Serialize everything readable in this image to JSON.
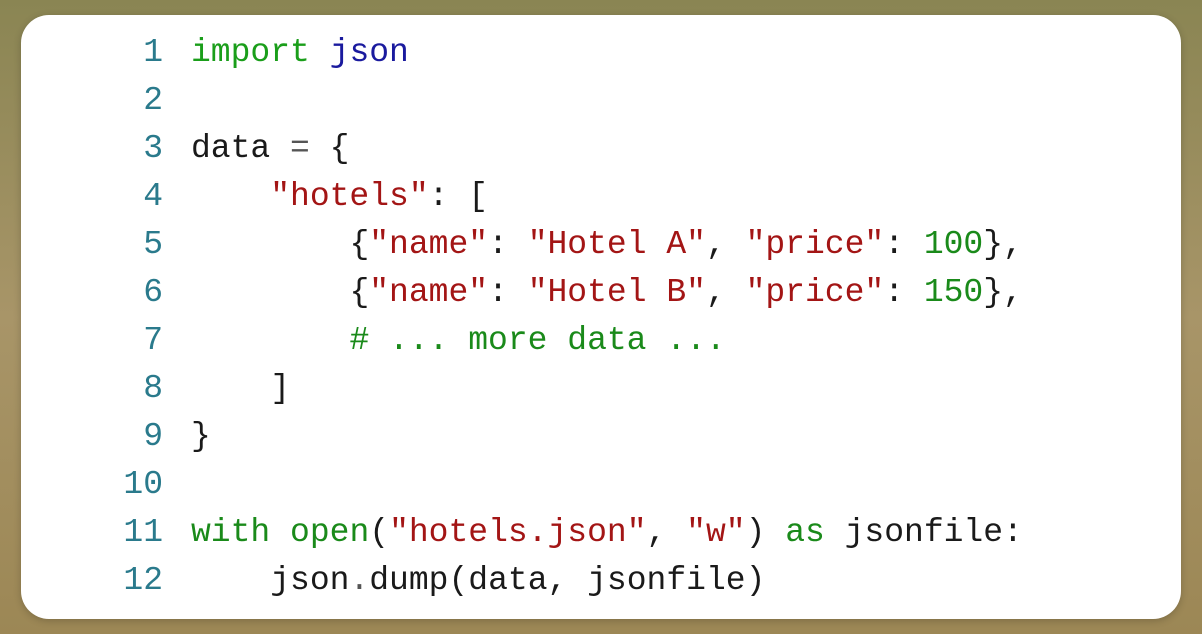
{
  "code": {
    "lines": [
      {
        "num": "1",
        "tokens": [
          {
            "cls": "kw-import",
            "t": "import"
          },
          {
            "cls": "",
            "t": " "
          },
          {
            "cls": "module",
            "t": "json"
          }
        ]
      },
      {
        "num": "2",
        "tokens": []
      },
      {
        "num": "3",
        "tokens": [
          {
            "cls": "var",
            "t": "data"
          },
          {
            "cls": "",
            "t": " "
          },
          {
            "cls": "op",
            "t": "="
          },
          {
            "cls": "",
            "t": " "
          },
          {
            "cls": "punct",
            "t": "{"
          }
        ]
      },
      {
        "num": "4",
        "tokens": [
          {
            "cls": "",
            "t": "    "
          },
          {
            "cls": "str",
            "t": "\"hotels\""
          },
          {
            "cls": "punct",
            "t": ":"
          },
          {
            "cls": "",
            "t": " "
          },
          {
            "cls": "punct",
            "t": "["
          }
        ]
      },
      {
        "num": "5",
        "tokens": [
          {
            "cls": "",
            "t": "        "
          },
          {
            "cls": "punct",
            "t": "{"
          },
          {
            "cls": "str",
            "t": "\"name\""
          },
          {
            "cls": "punct",
            "t": ":"
          },
          {
            "cls": "",
            "t": " "
          },
          {
            "cls": "str",
            "t": "\"Hotel A\""
          },
          {
            "cls": "punct",
            "t": ","
          },
          {
            "cls": "",
            "t": " "
          },
          {
            "cls": "str",
            "t": "\"price\""
          },
          {
            "cls": "punct",
            "t": ":"
          },
          {
            "cls": "",
            "t": " "
          },
          {
            "cls": "num",
            "t": "100"
          },
          {
            "cls": "punct",
            "t": "},"
          }
        ]
      },
      {
        "num": "6",
        "tokens": [
          {
            "cls": "",
            "t": "        "
          },
          {
            "cls": "punct",
            "t": "{"
          },
          {
            "cls": "str",
            "t": "\"name\""
          },
          {
            "cls": "punct",
            "t": ":"
          },
          {
            "cls": "",
            "t": " "
          },
          {
            "cls": "str",
            "t": "\"Hotel B\""
          },
          {
            "cls": "punct",
            "t": ","
          },
          {
            "cls": "",
            "t": " "
          },
          {
            "cls": "str",
            "t": "\"price\""
          },
          {
            "cls": "punct",
            "t": ":"
          },
          {
            "cls": "",
            "t": " "
          },
          {
            "cls": "num",
            "t": "150"
          },
          {
            "cls": "punct",
            "t": "},"
          }
        ]
      },
      {
        "num": "7",
        "tokens": [
          {
            "cls": "",
            "t": "        "
          },
          {
            "cls": "comment",
            "t": "# ... more data ..."
          }
        ]
      },
      {
        "num": "8",
        "tokens": [
          {
            "cls": "",
            "t": "    "
          },
          {
            "cls": "punct",
            "t": "]"
          }
        ]
      },
      {
        "num": "9",
        "tokens": [
          {
            "cls": "punct",
            "t": "}"
          }
        ]
      },
      {
        "num": "10",
        "tokens": []
      },
      {
        "num": "11",
        "tokens": [
          {
            "cls": "kw-with",
            "t": "with"
          },
          {
            "cls": "",
            "t": " "
          },
          {
            "cls": "func",
            "t": "open"
          },
          {
            "cls": "punct",
            "t": "("
          },
          {
            "cls": "str",
            "t": "\"hotels.json\""
          },
          {
            "cls": "punct",
            "t": ","
          },
          {
            "cls": "",
            "t": " "
          },
          {
            "cls": "str",
            "t": "\"w\""
          },
          {
            "cls": "punct",
            "t": ")"
          },
          {
            "cls": "",
            "t": " "
          },
          {
            "cls": "kw-as",
            "t": "as"
          },
          {
            "cls": "",
            "t": " "
          },
          {
            "cls": "var",
            "t": "jsonfile"
          },
          {
            "cls": "punct",
            "t": ":"
          }
        ]
      },
      {
        "num": "12",
        "tokens": [
          {
            "cls": "",
            "t": "    "
          },
          {
            "cls": "var",
            "t": "json"
          },
          {
            "cls": "op",
            "t": "."
          },
          {
            "cls": "var",
            "t": "dump"
          },
          {
            "cls": "punct",
            "t": "("
          },
          {
            "cls": "var",
            "t": "data"
          },
          {
            "cls": "punct",
            "t": ","
          },
          {
            "cls": "",
            "t": " "
          },
          {
            "cls": "var",
            "t": "jsonfile"
          },
          {
            "cls": "punct",
            "t": ")"
          }
        ]
      }
    ]
  }
}
